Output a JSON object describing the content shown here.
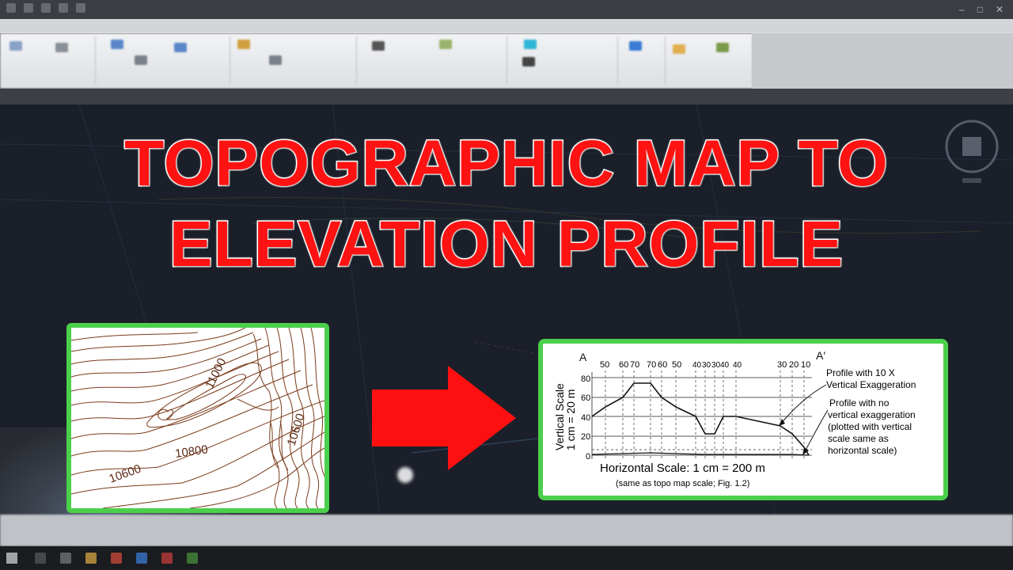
{
  "headline": {
    "line1": "TOPOGRAPHIC MAP TO",
    "line2": "ELEVATION PROFILE"
  },
  "colors": {
    "headline_fill": "#ff1212",
    "headline_outline": "#ffffff",
    "card_border": "#4bd04b",
    "arrow": "#ff1010",
    "contour": "#7a3b1b",
    "canvas": "#1b1f29"
  },
  "topo_map": {
    "labels": [
      "11000",
      "10800",
      "10600",
      "10600"
    ]
  },
  "profile": {
    "left_end": "A",
    "right_end": "A′",
    "top_labels": [
      "50",
      "60",
      "70",
      "70",
      "60",
      "50",
      "40",
      "30",
      "30",
      "40",
      "40",
      "30",
      "20",
      "10"
    ],
    "y_ticks": [
      "80",
      "60",
      "40",
      "20",
      "0"
    ],
    "y_axis_line1": "Vertical Scale",
    "y_axis_line2": "1 cm = 20 m",
    "x_caption": "Horizontal Scale: 1 cm = 200 m",
    "x_subcaption": "(same as topo map scale; Fig. 1.2)",
    "annotation_exag": [
      "Profile with 10 X",
      "Vertical Exaggeration"
    ],
    "annotation_noexag": [
      "Profile with no",
      "vertical exaggeration",
      "(plotted with vertical",
      "scale same as",
      "horizontal scale)"
    ]
  },
  "icons": {
    "arrow": "right-arrow-icon",
    "start": "windows-start-icon",
    "viewcube": "viewcube-icon"
  }
}
